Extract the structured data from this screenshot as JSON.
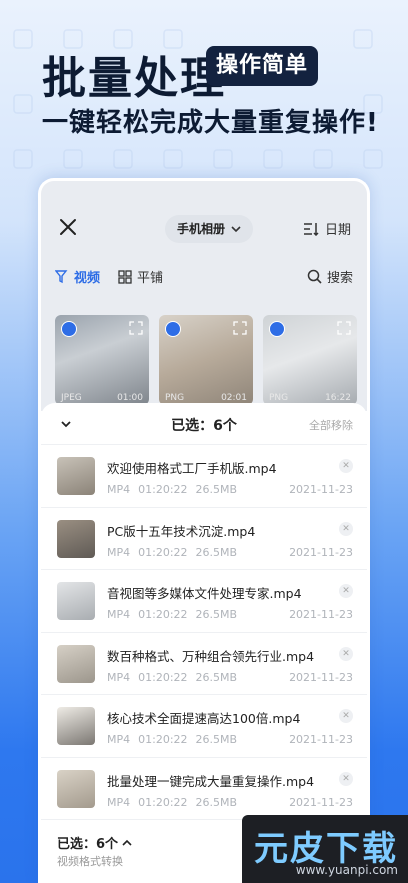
{
  "hero": {
    "title": "批量处理",
    "badge": "操作简单",
    "subtitle": "一键轻松完成大量重复操作!"
  },
  "app": {
    "album_label": "手机相册",
    "sort_label": "日期",
    "tabs": [
      {
        "label": "视频",
        "active": true
      },
      {
        "label": "平铺",
        "active": false
      }
    ],
    "search_label": "搜索",
    "thumbnails": [
      {
        "format": "JPEG",
        "duration": "01:00"
      },
      {
        "format": "PNG",
        "duration": "02:01"
      },
      {
        "format": "PNG",
        "duration": "16:22"
      }
    ],
    "sheet": {
      "selected_label": "已选：",
      "selected_count": "6个",
      "remove_all_label": "全部移除",
      "files": [
        {
          "name": "欢迎使用格式工厂手机版.mp4",
          "format": "MP4",
          "duration": "01:20:22",
          "size": "26.5MB",
          "date": "2021-11-23"
        },
        {
          "name": "PC版十五年技术沉淀.mp4",
          "format": "MP4",
          "duration": "01:20:22",
          "size": "26.5MB",
          "date": "2021-11-23"
        },
        {
          "name": "音视图等多媒体文件处理专家.mp4",
          "format": "MP4",
          "duration": "01:20:22",
          "size": "26.5MB",
          "date": "2021-11-23"
        },
        {
          "name": "数百种格式、万种组合领先行业.mp4",
          "format": "MP4",
          "duration": "01:20:22",
          "size": "26.5MB",
          "date": "2021-11-23"
        },
        {
          "name": "核心技术全面提速高达100倍.mp4",
          "format": "MP4",
          "duration": "01:20:22",
          "size": "26.5MB",
          "date": "2021-11-23"
        },
        {
          "name": "批量处理一键完成大量重复操作.mp4",
          "format": "MP4",
          "duration": "01:20:22",
          "size": "26.5MB",
          "date": "2021-11-23"
        }
      ],
      "footer_count": "已选：6个",
      "footer_sub": "视频格式转换"
    }
  },
  "watermark": {
    "logo": "元皮下载",
    "url": "www.yuanpi.com"
  },
  "colors": {
    "accent": "#2e6de6",
    "badge_bg": "#13223f",
    "hero_text": "#0d1b33"
  }
}
